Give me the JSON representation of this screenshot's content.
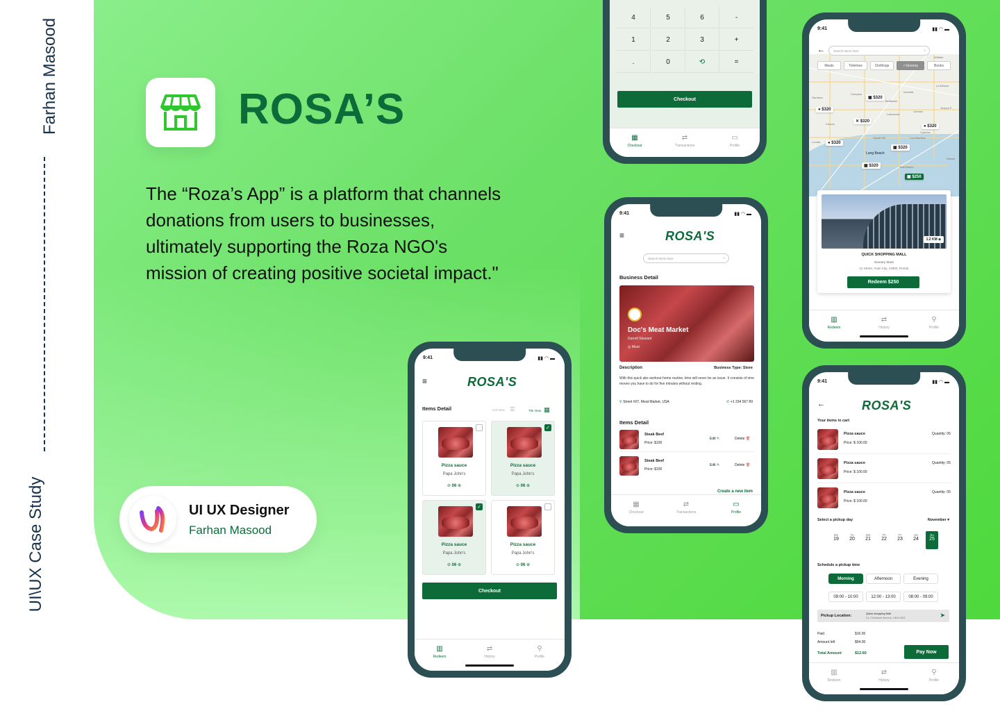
{
  "side": {
    "name": "Farhan Masood",
    "case": "UI\\UX Case Study"
  },
  "brand": {
    "title": "ROSA’S",
    "description": "The “Roza’s App” is a platform that channels donations from users to businesses, ultimately supporting the Roza NGO's mission of creating positive societal impact.\""
  },
  "designer": {
    "role": "UI UX Designer",
    "name": "Farhan Masood"
  },
  "colors": {
    "accent": "#0d6b3a",
    "panel": "#6be066",
    "frame": "#2b4f52"
  },
  "phone_keypad": {
    "keys": [
      "4",
      "5",
      "6",
      "-",
      "1",
      "2",
      "3",
      "+",
      ".",
      "0",
      "history-icon",
      "="
    ],
    "checkout": "Checkout",
    "nav": [
      "Checkout",
      "Transactions",
      "Profile"
    ]
  },
  "phone_map": {
    "time": "9:41",
    "search_placeholder": "Search items here",
    "chips": [
      "Meals",
      "Toiletries",
      "Clothings",
      "Grocery",
      "Books"
    ],
    "active_chip": "Grocery",
    "prices": [
      "$320",
      "$320",
      "$320",
      "$320",
      "$320",
      "$320",
      "$320",
      "$250"
    ],
    "places": [
      "Whittier",
      "Compton",
      "Norwalk",
      "La Mirada",
      "Gardena",
      "Bellflower",
      "Cerritos",
      "Buena P",
      "Lakewood",
      "Carson",
      "Cypress",
      "Lomita",
      "Signal Hill",
      "Los Alamitos",
      "Long Beach",
      "Westm",
      "Seal Beach"
    ],
    "card": {
      "distance": "1.2 KM",
      "title": "QUICK SHOPPING MALL",
      "type": "Grocery Store",
      "address": "12 Street, Yuan City, 12900, Florida",
      "button": "Redeem $250"
    },
    "nav": [
      "Redeem",
      "History",
      "Profile"
    ]
  },
  "phone_business": {
    "time": "9:41",
    "logo": "ROSA'S",
    "search_placeholder": "Search items here",
    "section_title": "Business Detail",
    "business_name": "Doc's Meat Market",
    "owner": "Darrell Steward",
    "category": "Meat",
    "description_label": "Description",
    "business_type": "Business Type: Store",
    "description": "With this quick abs workout home routine, time will never be an issue. It consists of nine moves you have to do for five minutes without resting.",
    "address": "Street #07, Meat Market, USA",
    "phone": "+1 234 567 89",
    "items_title": "Items Detail",
    "items": [
      {
        "name": "Steak Beef",
        "price": "Price: $100",
        "edit": "Edit",
        "delete": "Delete"
      },
      {
        "name": "Steak Beef",
        "price": "Price: $100",
        "edit": "Edit",
        "delete": "Delete"
      }
    ],
    "create": "Create a new item",
    "nav": [
      "Checkout",
      "Transactions",
      "Profile"
    ]
  },
  "phone_items": {
    "time": "9:41",
    "logo": "ROSA'S",
    "title": "Items Detail",
    "list_view": "List View",
    "tile_view": "Tile View",
    "tiles": [
      {
        "name": "Pizza sauce",
        "sub": "Papa John's",
        "qty": "06",
        "checked": false
      },
      {
        "name": "Pizza sauce",
        "sub": "Papa John's",
        "qty": "06",
        "checked": true
      },
      {
        "name": "Pizza sauce",
        "sub": "Papa John's",
        "qty": "06",
        "checked": true
      },
      {
        "name": "Pizza sauce",
        "sub": "Papa John's",
        "qty": "06",
        "checked": false
      }
    ],
    "checkout": "Checkout",
    "nav": [
      "Redeem",
      "History",
      "Profile"
    ]
  },
  "phone_cart": {
    "time": "9:41",
    "logo": "ROSA'S",
    "title": "Your items in cart",
    "items": [
      {
        "name": "Pizza sauce",
        "price": "Price: $ 100.00",
        "qty": "Quantity: 05"
      },
      {
        "name": "Pizza sauce",
        "price": "Price: $ 100.00",
        "qty": "Quantity: 05"
      },
      {
        "name": "Pizza sauce",
        "price": "Price: $ 100.00",
        "qty": "Quantity: 05"
      }
    ],
    "pickup_day": "Select a pickup day",
    "month": "November",
    "days": [
      {
        "d": "Mo",
        "n": "19"
      },
      {
        "d": "Tu",
        "n": "20"
      },
      {
        "d": "We",
        "n": "21"
      },
      {
        "d": "Th",
        "n": "22"
      },
      {
        "d": "Fr",
        "n": "23"
      },
      {
        "d": "Sa",
        "n": "24"
      },
      {
        "d": "Su",
        "n": "25"
      }
    ],
    "schedule": "Schedule a pickup time",
    "periods": [
      "Morning",
      "Afternoon",
      "Evening"
    ],
    "slots": [
      "09:00 - 10:00",
      "12:00 - 13:00",
      "08:00 - 09:00"
    ],
    "location_label": "Pickup Location:",
    "location_name": "Quick shopping Mall",
    "location_addr": "24, Florisdore Avenue, UB10 8DZ",
    "paid_label": "Paid",
    "paid": "$16.00",
    "left_label": "Amount left",
    "left": "$04.00",
    "total_label": "Total Amount",
    "total": "$12.60",
    "pay": "Pay Now",
    "nav": [
      "Redeem",
      "History",
      "Profile"
    ]
  }
}
